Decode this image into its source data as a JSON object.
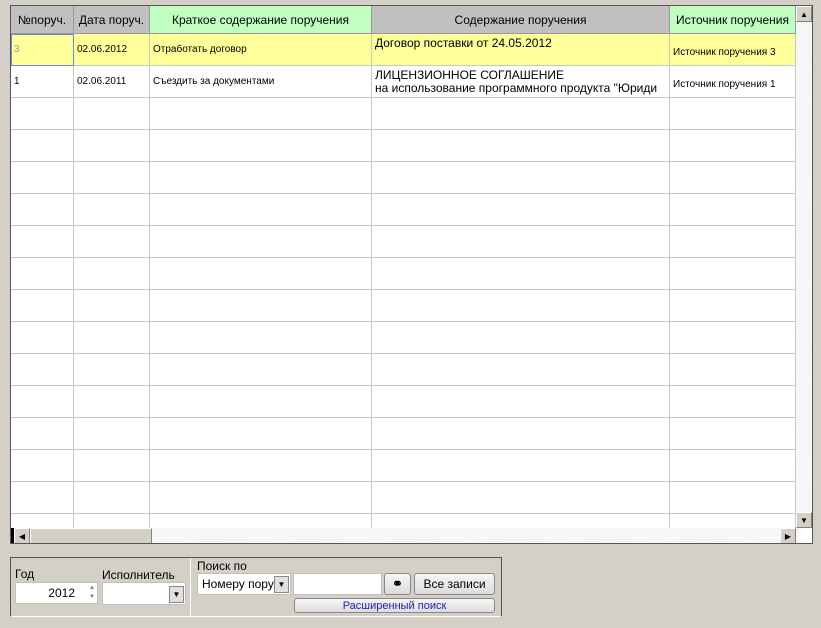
{
  "grid": {
    "columns": [
      {
        "label": "№поруч.",
        "bg": "#c0c0c0"
      },
      {
        "label": "Дата поруч.",
        "bg": "#c0c0c0"
      },
      {
        "label": "Краткое содержание поручения",
        "bg": "#c0ffc0"
      },
      {
        "label": "Содержание поручения",
        "bg": "#c0c0c0"
      },
      {
        "label": "Источник поручения",
        "bg": "#c0ffc0"
      }
    ],
    "rows": [
      {
        "num": "3",
        "date": "02.06.2012",
        "short": "Отработать договор",
        "content1": "Договор поставки от 24.05.2012",
        "content2": "",
        "source": "Источник поручения 3",
        "selected": true
      },
      {
        "num": "1",
        "date": "02.06.2011",
        "short": "Съездить за документами",
        "content1": "ЛИЦЕНЗИОННОЕ СОГЛАШЕНИЕ",
        "content2": "на использование программного продукта \"Юриди",
        "source": "Источник поручения 1",
        "selected": false
      }
    ],
    "selected_color": "#ffff99"
  },
  "filters": {
    "year_label": "Год",
    "year_value": "2012",
    "executor_label": "Исполнитель",
    "executor_value": "",
    "search_label": "Поиск по",
    "search_field": "Номеру пору",
    "search_value": "",
    "all_records": "Все записи",
    "advanced_search": "Расширенный поиск"
  }
}
